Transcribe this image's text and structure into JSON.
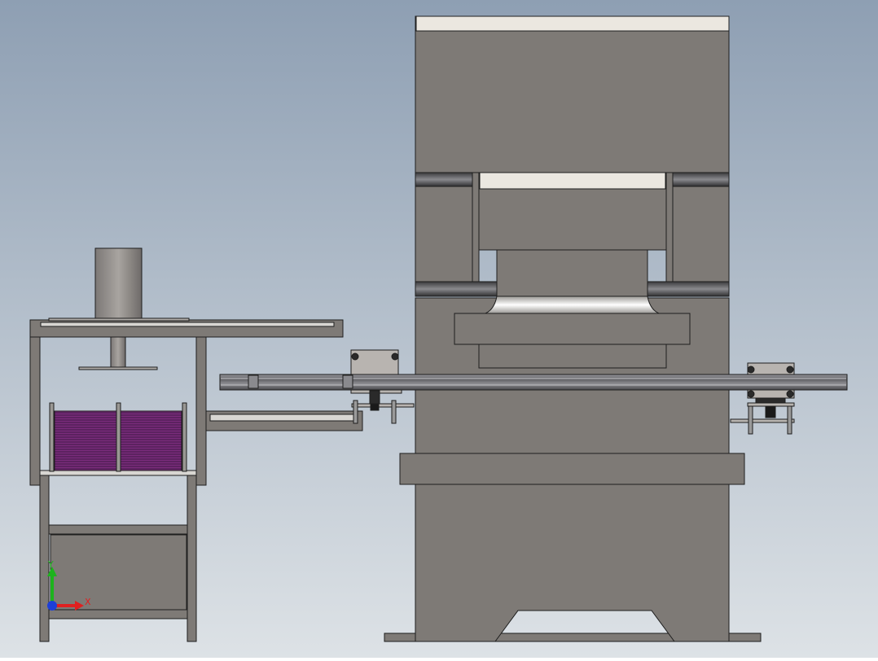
{
  "viewport": {
    "background_top": "#8e9fb3",
    "background_bottom": "#dde2e6"
  },
  "colors": {
    "body": "#7e7a76",
    "body_dark": "#5b5856",
    "outline": "#1e1e1e",
    "highlight": "#ebe7e0",
    "rail": "#6c6c70",
    "stack": "#7b2c7c"
  },
  "triad": {
    "y_label": "Y",
    "x_label": "X",
    "y_color": "#1db31d",
    "x_color": "#e02020",
    "z_color": "#1d3fd8"
  }
}
